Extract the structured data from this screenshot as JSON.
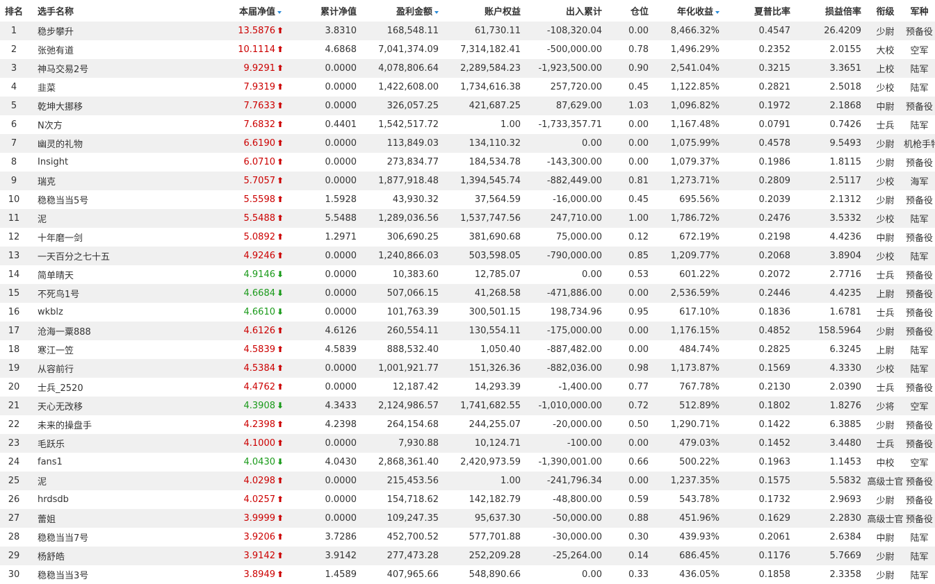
{
  "header": {
    "rank": "排名",
    "name": "选手名称",
    "nav": "本届净值",
    "cum_nav": "累计净值",
    "profit": "盈利金额",
    "equity": "账户权益",
    "flow": "出入累计",
    "position": "仓位",
    "annual": "年化收益",
    "sharpe": "夏普比率",
    "pl_ratio": "损益倍率",
    "rank_title": "衔级",
    "branch": "军种"
  },
  "colors": {
    "up": "#cc0000",
    "down": "#1a9a1a",
    "sort": "#2a8ad8",
    "stripe": "#f0f0f0"
  },
  "icons": {
    "up": "arrow-up-icon",
    "down": "arrow-down-icon",
    "sort": "sort-desc-icon"
  },
  "rows": [
    {
      "rank": "1",
      "name": "稳步攀升",
      "nav": "13.5876",
      "dir": "up",
      "cum": "3.8310",
      "profit": "168,548.11",
      "equity": "61,730.11",
      "flow": "-108,320.04",
      "pos": "0.00",
      "annual": "8,466.32%",
      "sharpe": "0.4547",
      "plr": "26.4209",
      "title": "少尉",
      "branch": "预备役"
    },
    {
      "rank": "2",
      "name": "张弛有道",
      "nav": "10.1114",
      "dir": "up",
      "cum": "4.6868",
      "profit": "7,041,374.09",
      "equity": "7,314,182.41",
      "flow": "-500,000.00",
      "pos": "0.78",
      "annual": "1,496.29%",
      "sharpe": "0.2352",
      "plr": "2.0155",
      "title": "大校",
      "branch": "空军"
    },
    {
      "rank": "3",
      "name": "神马交易2号",
      "nav": "9.9291",
      "dir": "up",
      "cum": "0.0000",
      "profit": "4,078,806.64",
      "equity": "2,289,584.23",
      "flow": "-1,923,500.00",
      "pos": "0.90",
      "annual": "2,541.04%",
      "sharpe": "0.3215",
      "plr": "3.3651",
      "title": "上校",
      "branch": "陆军"
    },
    {
      "rank": "4",
      "name": "韭菜",
      "nav": "7.9319",
      "dir": "up",
      "cum": "0.0000",
      "profit": "1,422,608.00",
      "equity": "1,734,616.38",
      "flow": "257,720.00",
      "pos": "0.45",
      "annual": "1,122.85%",
      "sharpe": "0.2821",
      "plr": "2.5018",
      "title": "少校",
      "branch": "陆军"
    },
    {
      "rank": "5",
      "name": "乾坤大挪移",
      "nav": "7.7633",
      "dir": "up",
      "cum": "0.0000",
      "profit": "326,057.25",
      "equity": "421,687.25",
      "flow": "87,629.00",
      "pos": "1.03",
      "annual": "1,096.82%",
      "sharpe": "0.1972",
      "plr": "2.1868",
      "title": "中尉",
      "branch": "预备役"
    },
    {
      "rank": "6",
      "name": "N次方",
      "nav": "7.6832",
      "dir": "up",
      "cum": "0.4401",
      "profit": "1,542,517.72",
      "equity": "1.00",
      "flow": "-1,733,357.71",
      "pos": "0.00",
      "annual": "1,167.48%",
      "sharpe": "0.0791",
      "plr": "0.7426",
      "title": "士兵",
      "branch": "陆军"
    },
    {
      "rank": "7",
      "name": "幽灵的礼物",
      "nav": "6.6190",
      "dir": "up",
      "cum": "0.0000",
      "profit": "113,849.03",
      "equity": "134,110.32",
      "flow": "0.00",
      "pos": "0.00",
      "annual": "1,075.99%",
      "sharpe": "0.4578",
      "plr": "9.5493",
      "title": "少尉",
      "branch": "机枪手特战营"
    },
    {
      "rank": "8",
      "name": "Insight",
      "nav": "6.0710",
      "dir": "up",
      "cum": "0.0000",
      "profit": "273,834.77",
      "equity": "184,534.78",
      "flow": "-143,300.00",
      "pos": "0.00",
      "annual": "1,079.37%",
      "sharpe": "0.1986",
      "plr": "1.8115",
      "title": "少尉",
      "branch": "预备役"
    },
    {
      "rank": "9",
      "name": "瑞克",
      "nav": "5.7057",
      "dir": "up",
      "cum": "0.0000",
      "profit": "1,877,918.48",
      "equity": "1,394,545.74",
      "flow": "-882,449.00",
      "pos": "0.81",
      "annual": "1,273.71%",
      "sharpe": "0.2809",
      "plr": "2.5117",
      "title": "少校",
      "branch": "海军"
    },
    {
      "rank": "10",
      "name": "稳稳当当5号",
      "nav": "5.5598",
      "dir": "up",
      "cum": "1.5928",
      "profit": "43,930.32",
      "equity": "37,564.59",
      "flow": "-16,000.00",
      "pos": "0.45",
      "annual": "695.56%",
      "sharpe": "0.2039",
      "plr": "2.1312",
      "title": "少尉",
      "branch": "预备役"
    },
    {
      "rank": "11",
      "name": "泥",
      "nav": "5.5488",
      "dir": "up",
      "cum": "5.5488",
      "profit": "1,289,036.56",
      "equity": "1,537,747.56",
      "flow": "247,710.00",
      "pos": "1.00",
      "annual": "1,786.72%",
      "sharpe": "0.2476",
      "plr": "3.5332",
      "title": "少校",
      "branch": "陆军"
    },
    {
      "rank": "12",
      "name": "十年磨一剑",
      "nav": "5.0892",
      "dir": "up",
      "cum": "1.2971",
      "profit": "306,690.25",
      "equity": "381,690.68",
      "flow": "75,000.00",
      "pos": "0.12",
      "annual": "672.19%",
      "sharpe": "0.2198",
      "plr": "4.4236",
      "title": "中尉",
      "branch": "预备役"
    },
    {
      "rank": "13",
      "name": "一天百分之七十五",
      "nav": "4.9246",
      "dir": "up",
      "cum": "0.0000",
      "profit": "1,240,866.03",
      "equity": "503,598.05",
      "flow": "-790,000.00",
      "pos": "0.85",
      "annual": "1,209.77%",
      "sharpe": "0.2068",
      "plr": "3.8904",
      "title": "少校",
      "branch": "陆军"
    },
    {
      "rank": "14",
      "name": "简单晴天",
      "nav": "4.9146",
      "dir": "down",
      "cum": "0.0000",
      "profit": "10,383.60",
      "equity": "12,785.07",
      "flow": "0.00",
      "pos": "0.53",
      "annual": "601.22%",
      "sharpe": "0.2072",
      "plr": "2.7716",
      "title": "士兵",
      "branch": "预备役"
    },
    {
      "rank": "15",
      "name": "不死鸟1号",
      "nav": "4.6684",
      "dir": "down",
      "cum": "0.0000",
      "profit": "507,066.15",
      "equity": "41,268.58",
      "flow": "-471,886.00",
      "pos": "0.00",
      "annual": "2,536.59%",
      "sharpe": "0.2446",
      "plr": "4.4235",
      "title": "上尉",
      "branch": "预备役"
    },
    {
      "rank": "16",
      "name": "wkblz",
      "nav": "4.6610",
      "dir": "down",
      "cum": "0.0000",
      "profit": "101,763.39",
      "equity": "300,501.15",
      "flow": "198,734.96",
      "pos": "0.95",
      "annual": "617.10%",
      "sharpe": "0.1836",
      "plr": "1.6781",
      "title": "士兵",
      "branch": "预备役"
    },
    {
      "rank": "17",
      "name": "沧海一粟888",
      "nav": "4.6126",
      "dir": "up",
      "cum": "4.6126",
      "profit": "260,554.11",
      "equity": "130,554.11",
      "flow": "-175,000.00",
      "pos": "0.00",
      "annual": "1,176.15%",
      "sharpe": "0.4852",
      "plr": "158.5964",
      "title": "少尉",
      "branch": "预备役"
    },
    {
      "rank": "18",
      "name": "寒江一笠",
      "nav": "4.5839",
      "dir": "up",
      "cum": "4.5839",
      "profit": "888,532.40",
      "equity": "1,050.40",
      "flow": "-887,482.00",
      "pos": "0.00",
      "annual": "484.74%",
      "sharpe": "0.2825",
      "plr": "6.3245",
      "title": "上尉",
      "branch": "陆军"
    },
    {
      "rank": "19",
      "name": "从容前行",
      "nav": "4.5384",
      "dir": "up",
      "cum": "0.0000",
      "profit": "1,001,921.77",
      "equity": "151,326.36",
      "flow": "-882,036.00",
      "pos": "0.98",
      "annual": "1,173.87%",
      "sharpe": "0.1569",
      "plr": "4.3330",
      "title": "少校",
      "branch": "陆军"
    },
    {
      "rank": "20",
      "name": "士兵_2520",
      "nav": "4.4762",
      "dir": "up",
      "cum": "0.0000",
      "profit": "12,187.42",
      "equity": "14,293.39",
      "flow": "-1,400.00",
      "pos": "0.77",
      "annual": "767.78%",
      "sharpe": "0.2130",
      "plr": "2.0390",
      "title": "士兵",
      "branch": "预备役"
    },
    {
      "rank": "21",
      "name": "天心无改移",
      "nav": "4.3908",
      "dir": "down",
      "cum": "4.3433",
      "profit": "2,124,986.57",
      "equity": "1,741,682.55",
      "flow": "-1,010,000.00",
      "pos": "0.72",
      "annual": "512.89%",
      "sharpe": "0.1802",
      "plr": "1.8276",
      "title": "少将",
      "branch": "空军"
    },
    {
      "rank": "22",
      "name": "未来的操盘手",
      "nav": "4.2398",
      "dir": "up",
      "cum": "4.2398",
      "profit": "264,154.68",
      "equity": "244,255.07",
      "flow": "-20,000.00",
      "pos": "0.50",
      "annual": "1,290.71%",
      "sharpe": "0.1422",
      "plr": "6.3885",
      "title": "少尉",
      "branch": "预备役"
    },
    {
      "rank": "23",
      "name": "毛跃乐",
      "nav": "4.1000",
      "dir": "up",
      "cum": "0.0000",
      "profit": "7,930.88",
      "equity": "10,124.71",
      "flow": "-100.00",
      "pos": "0.00",
      "annual": "479.03%",
      "sharpe": "0.1452",
      "plr": "3.4480",
      "title": "士兵",
      "branch": "预备役"
    },
    {
      "rank": "24",
      "name": "fans1",
      "nav": "4.0430",
      "dir": "down",
      "cum": "4.0430",
      "profit": "2,868,361.40",
      "equity": "2,420,973.59",
      "flow": "-1,390,001.00",
      "pos": "0.66",
      "annual": "500.22%",
      "sharpe": "0.1963",
      "plr": "1.1453",
      "title": "中校",
      "branch": "空军"
    },
    {
      "rank": "25",
      "name": "泥",
      "nav": "4.0298",
      "dir": "up",
      "cum": "0.0000",
      "profit": "215,453.56",
      "equity": "1.00",
      "flow": "-241,796.34",
      "pos": "0.00",
      "annual": "1,237.35%",
      "sharpe": "0.1575",
      "plr": "5.5832",
      "title": "高级士官",
      "branch": "预备役"
    },
    {
      "rank": "26",
      "name": "hrdsdb",
      "nav": "4.0257",
      "dir": "up",
      "cum": "0.0000",
      "profit": "154,718.62",
      "equity": "142,182.79",
      "flow": "-48,800.00",
      "pos": "0.59",
      "annual": "543.78%",
      "sharpe": "0.1732",
      "plr": "2.9693",
      "title": "少尉",
      "branch": "预备役"
    },
    {
      "rank": "27",
      "name": "蕾姐",
      "nav": "3.9999",
      "dir": "up",
      "cum": "0.0000",
      "profit": "109,247.35",
      "equity": "95,637.30",
      "flow": "-50,000.00",
      "pos": "0.88",
      "annual": "451.96%",
      "sharpe": "0.1629",
      "plr": "2.2830",
      "title": "高级士官",
      "branch": "预备役"
    },
    {
      "rank": "28",
      "name": "稳稳当当7号",
      "nav": "3.9206",
      "dir": "up",
      "cum": "3.7286",
      "profit": "452,700.52",
      "equity": "577,701.88",
      "flow": "-30,000.00",
      "pos": "0.30",
      "annual": "439.93%",
      "sharpe": "0.2061",
      "plr": "2.6384",
      "title": "中尉",
      "branch": "陆军"
    },
    {
      "rank": "29",
      "name": "杨舒皓",
      "nav": "3.9142",
      "dir": "up",
      "cum": "3.9142",
      "profit": "277,473.28",
      "equity": "252,209.28",
      "flow": "-25,264.00",
      "pos": "0.14",
      "annual": "686.45%",
      "sharpe": "0.1176",
      "plr": "5.7669",
      "title": "少尉",
      "branch": "陆军"
    },
    {
      "rank": "30",
      "name": "稳稳当当3号",
      "nav": "3.8949",
      "dir": "up",
      "cum": "1.4589",
      "profit": "407,965.66",
      "equity": "548,890.66",
      "flow": "0.00",
      "pos": "0.33",
      "annual": "436.05%",
      "sharpe": "0.1858",
      "plr": "2.3358",
      "title": "少尉",
      "branch": "陆军"
    }
  ]
}
